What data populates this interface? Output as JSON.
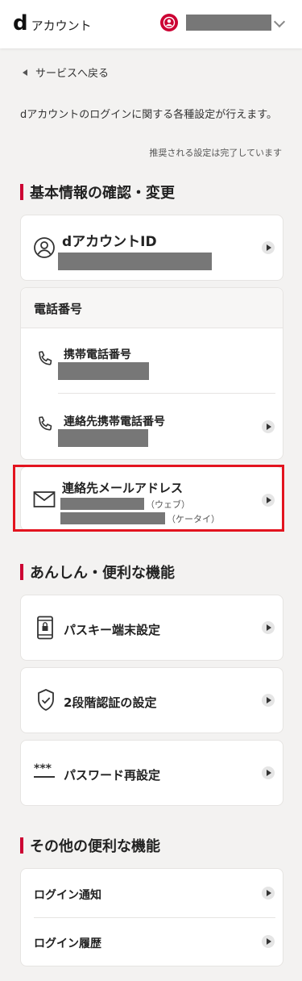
{
  "header": {
    "logo_mark": "d",
    "logo_text": "アカウント"
  },
  "back_link": "サービスへ戻る",
  "intro_text": "dアカウントのログインに関する各種設定が行えます。",
  "status_text": "推奨される設定は完了しています",
  "sections": {
    "basic": {
      "title": "基本情報の確認・変更",
      "account_id_label": "dアカウントID",
      "phone_header": "電話番号",
      "mobile_label": "携帯電話番号",
      "contact_mobile_label": "連絡先携帯電話番号",
      "email_label": "連絡先メールアドレス",
      "email_web_suffix": "（ウェブ）",
      "email_mobile_suffix": "（ケータイ）"
    },
    "security": {
      "title": "あんしん・便利な機能",
      "passkey_label": "パスキー端末設定",
      "two_step_label": "2段階認証の設定",
      "password_label": "パスワード再設定",
      "password_icon_text": "***"
    },
    "other": {
      "title": "その他の便利な機能",
      "login_notice_label": "ログイン通知",
      "login_history_label": "ログイン履歴"
    }
  },
  "colors": {
    "accent": "#cc0033",
    "highlight": "#e3141f",
    "mask": "#777777"
  }
}
